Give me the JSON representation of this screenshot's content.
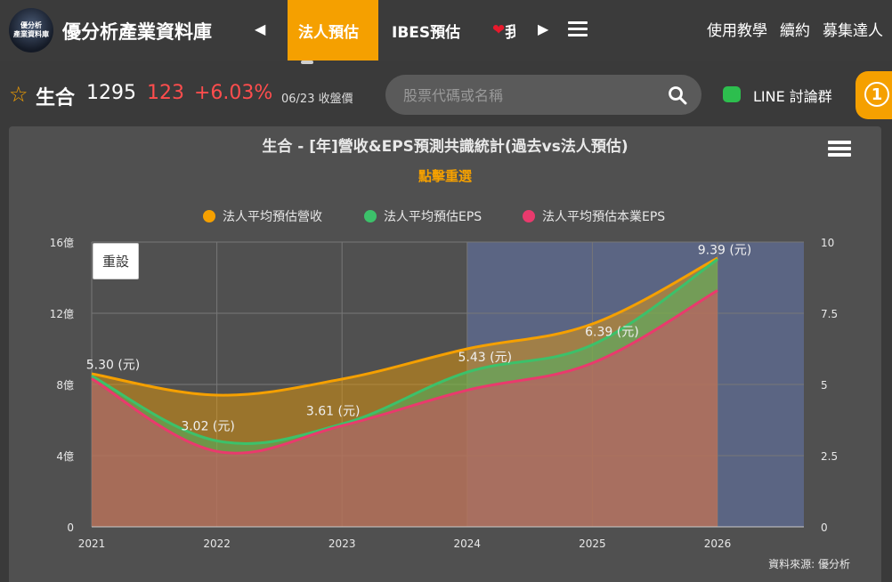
{
  "app": {
    "logo_line1": "優分析",
    "logo_line2": "產業資料庫",
    "brand": "優分析產業資料庫"
  },
  "nav": {
    "tabs": [
      {
        "label": "法人預估",
        "active": true
      },
      {
        "label": "IBES預估",
        "active": false
      },
      {
        "label": "我",
        "active": false
      }
    ],
    "right_links": [
      "使用教學",
      "續約",
      "募集達人"
    ]
  },
  "stock": {
    "name": "生合",
    "code": "1295",
    "price": "123",
    "change": "+6.03%",
    "date_label": "06/23 收盤價"
  },
  "search": {
    "placeholder": "股票代碼或名稱"
  },
  "line": {
    "label": "LINE 討論群"
  },
  "badge": {
    "count": "1"
  },
  "chart_data": {
    "type": "area",
    "title": "生合 - [年]營收&EPS預測共識統計(過去vs法人預估)",
    "subtitle": "點擊重選",
    "reset_label": "重設",
    "source": "資料來源: 優分析",
    "x": [
      "2021",
      "2022",
      "2023",
      "2024",
      "2025",
      "2026"
    ],
    "forecast_band_start": "2024",
    "y_left": {
      "ticks": [
        "0",
        "4億",
        "8億",
        "12億",
        "16億"
      ],
      "range": [
        0,
        16
      ]
    },
    "y_right": {
      "ticks": [
        "0",
        "2.5",
        "5",
        "7.5",
        "10"
      ],
      "range": [
        0,
        10
      ]
    },
    "series": [
      {
        "name": "法人平均預估營收",
        "color": "#f5a000",
        "axis": "left",
        "values": [
          8.6,
          7.4,
          8.3,
          10.0,
          11.4,
          15.1
        ]
      },
      {
        "name": "法人平均預估EPS",
        "color": "#3cc16a",
        "axis": "right",
        "values": [
          5.3,
          3.02,
          3.61,
          5.43,
          6.39,
          9.39
        ]
      },
      {
        "name": "法人平均預估本業EPS",
        "color": "#e93a6d",
        "axis": "right",
        "values": [
          5.2,
          2.65,
          3.55,
          4.8,
          5.75,
          8.3
        ]
      }
    ],
    "data_labels": [
      "5.30 (元)",
      "3.02 (元)",
      "3.61 (元)",
      "5.43 (元)",
      "6.39 (元)",
      "9.39 (元)"
    ],
    "grid": true,
    "legend_position": "top"
  }
}
